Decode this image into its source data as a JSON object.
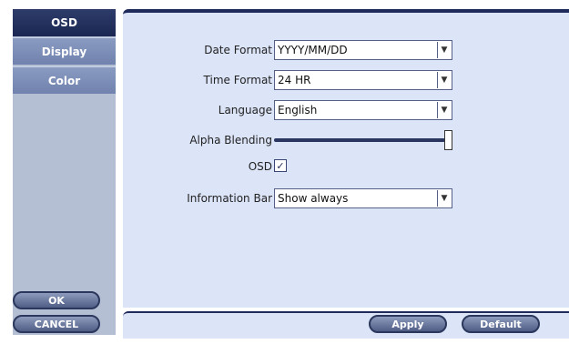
{
  "sidebar": {
    "tabs": [
      {
        "label": "OSD"
      },
      {
        "label": "Display"
      },
      {
        "label": "Color"
      }
    ],
    "ok_label": "OK",
    "cancel_label": "CANCEL"
  },
  "settings": {
    "date_format": {
      "label": "Date Format",
      "value": "YYYY/MM/DD"
    },
    "time_format": {
      "label": "Time Format",
      "value": "24 HR"
    },
    "language": {
      "label": "Language",
      "value": "English"
    },
    "alpha_blending": {
      "label": "Alpha Blending",
      "level": 1.0
    },
    "osd": {
      "label": "OSD",
      "checked": true,
      "check_glyph": "✓"
    },
    "information_bar": {
      "label": "Information Bar",
      "value": "Show always"
    }
  },
  "footer": {
    "apply_label": "Apply",
    "default_label": "Default"
  },
  "icons": {
    "dropdown": "chevron-down-icon",
    "check": "check-icon"
  }
}
